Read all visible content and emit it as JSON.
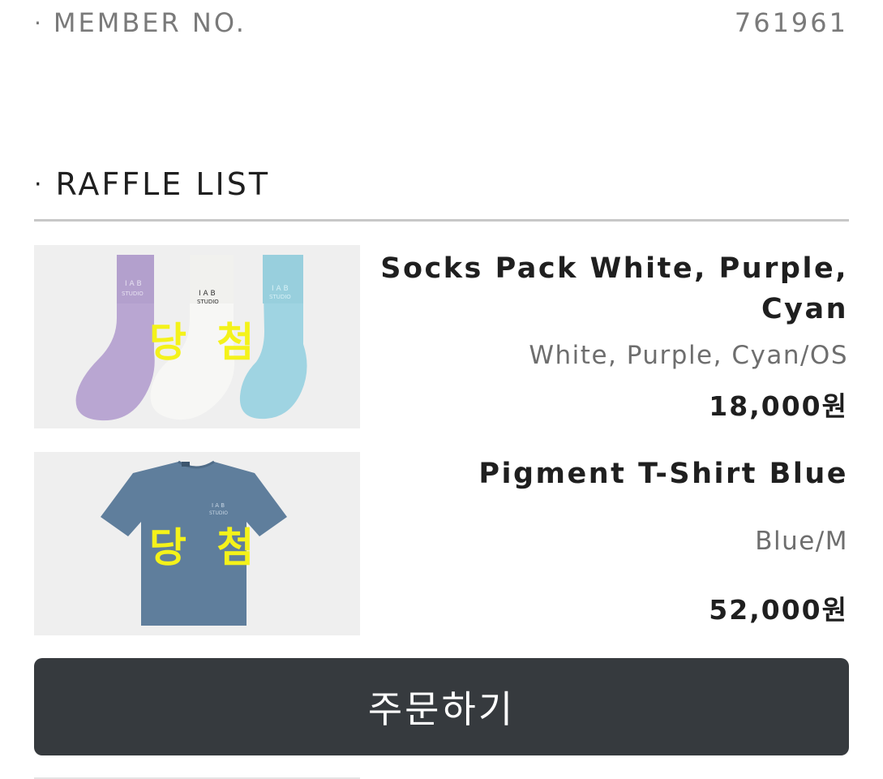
{
  "member": {
    "label": "MEMBER NO.",
    "value": "761961"
  },
  "raffle": {
    "title": "RAFFLE LIST",
    "items": [
      {
        "name": "Socks Pack White, Purple, Cyan",
        "option": "White, Purple, Cyan/OS",
        "price": "18,000원",
        "badge": "당 첨"
      },
      {
        "name": "Pigment T-Shirt Blue",
        "option": "Blue/M",
        "price": "52,000원",
        "badge": "당 첨"
      }
    ]
  },
  "order_button": {
    "label": "주문하기"
  },
  "colors": {
    "button_bg": "#363a3e",
    "badge_yellow": "#f4f21a",
    "divider": "#c8c8c8",
    "muted_text": "#7a7a7a"
  }
}
